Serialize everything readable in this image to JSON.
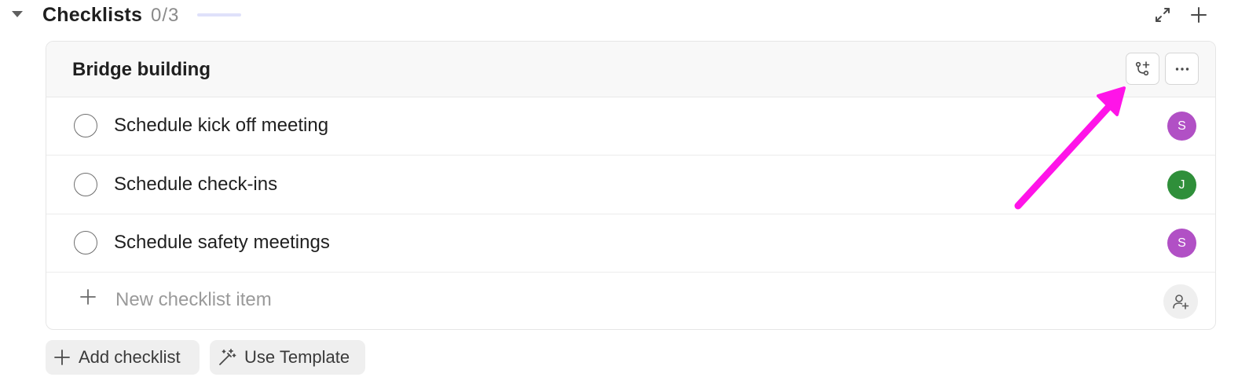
{
  "section": {
    "title": "Checklists",
    "count": "0/3",
    "progress": 0,
    "expand_icon": "expand-arrows-icon",
    "add_icon": "plus-icon"
  },
  "checklist": {
    "title": "Bridge building",
    "actions": {
      "assign_icon": "branch-plus-icon",
      "more_icon": "ellipsis-icon"
    },
    "items": [
      {
        "label": "Schedule kick off meeting",
        "checked": false,
        "assignee": "S",
        "assignee_color": "#b150c5"
      },
      {
        "label": "Schedule check-ins",
        "checked": false,
        "assignee": "J",
        "assignee_color": "#2f8f3a"
      },
      {
        "label": "Schedule safety meetings",
        "checked": false,
        "assignee": "S",
        "assignee_color": "#b150c5"
      }
    ],
    "new_item_placeholder": "New checklist item",
    "new_item_value": ""
  },
  "footer": {
    "add_checklist_label": "Add checklist",
    "use_template_label": "Use Template"
  },
  "colors": {
    "accent": "#7b68ee",
    "annotation_arrow": "#ff14e8"
  }
}
